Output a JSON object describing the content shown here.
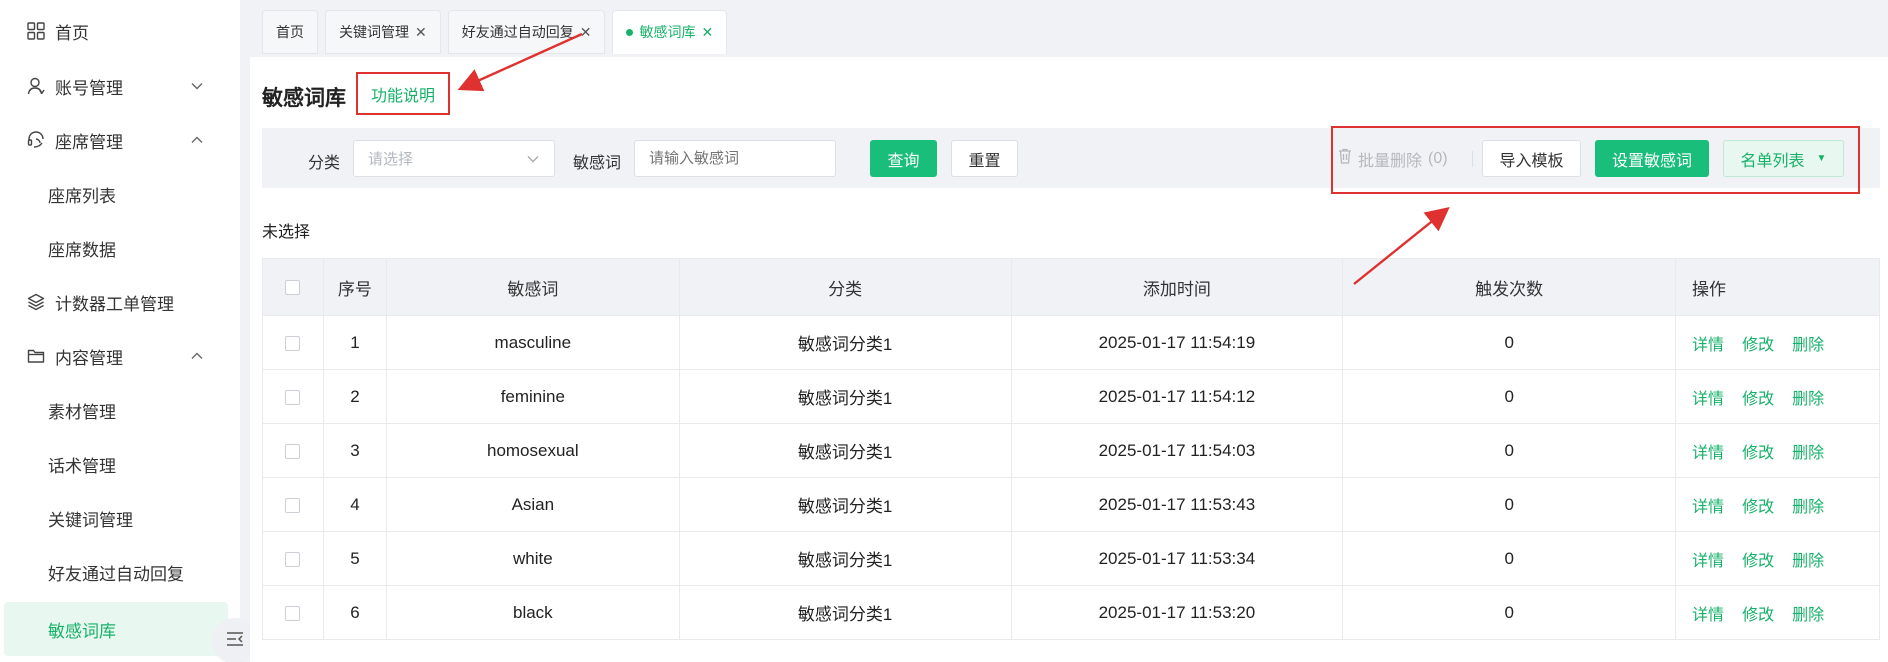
{
  "sidebar": {
    "items": [
      {
        "label": "首页"
      },
      {
        "label": "账号管理"
      },
      {
        "label": "座席管理"
      },
      {
        "label": "座席列表"
      },
      {
        "label": "座席数据"
      },
      {
        "label": "计数器工单管理"
      },
      {
        "label": "内容管理"
      },
      {
        "label": "素材管理"
      },
      {
        "label": "话术管理"
      },
      {
        "label": "关键词管理"
      },
      {
        "label": "好友通过自动回复"
      },
      {
        "label": "敏感词库"
      }
    ]
  },
  "tabs": [
    {
      "label": "首页"
    },
    {
      "label": "关键词管理"
    },
    {
      "label": "好友通过自动回复"
    },
    {
      "label": "敏感词库"
    }
  ],
  "page": {
    "title": "敏感词库",
    "func_link": "功能说明",
    "selection_text": "未选择"
  },
  "filter": {
    "category_label": "分类",
    "category_placeholder": "请选择",
    "word_label": "敏感词",
    "word_placeholder": "请输入敏感词",
    "query_btn": "查询",
    "reset_btn": "重置"
  },
  "actions": {
    "batch_delete": "批量删除",
    "batch_count": "(0)",
    "import_template": "导入模板",
    "set_words": "设置敏感词",
    "name_list": "名单列表"
  },
  "table": {
    "headers": [
      "序号",
      "敏感词",
      "分类",
      "添加时间",
      "触发次数",
      "操作"
    ],
    "ops": [
      "详情",
      "修改",
      "删除"
    ],
    "rows": [
      {
        "no": "1",
        "word": "masculine",
        "category": "敏感词分类1",
        "time": "2025-01-17 11:54:19",
        "count": "0"
      },
      {
        "no": "2",
        "word": "feminine",
        "category": "敏感词分类1",
        "time": "2025-01-17 11:54:12",
        "count": "0"
      },
      {
        "no": "3",
        "word": "homosexual",
        "category": "敏感词分类1",
        "time": "2025-01-17 11:54:03",
        "count": "0"
      },
      {
        "no": "4",
        "word": "Asian",
        "category": "敏感词分类1",
        "time": "2025-01-17 11:53:43",
        "count": "0"
      },
      {
        "no": "5",
        "word": "white",
        "category": "敏感词分类1",
        "time": "2025-01-17 11:53:34",
        "count": "0"
      },
      {
        "no": "6",
        "word": "black",
        "category": "敏感词分类1",
        "time": "2025-01-17 11:53:20",
        "count": "0"
      }
    ]
  },
  "colors": {
    "accent": "#17b26a",
    "annotation": "#e03131"
  },
  "icons": [
    "grid-icon",
    "user-icon",
    "headset-icon",
    "layers-icon",
    "folder-icon",
    "trash-icon",
    "caret-down-icon",
    "menu-fold-icon"
  ]
}
